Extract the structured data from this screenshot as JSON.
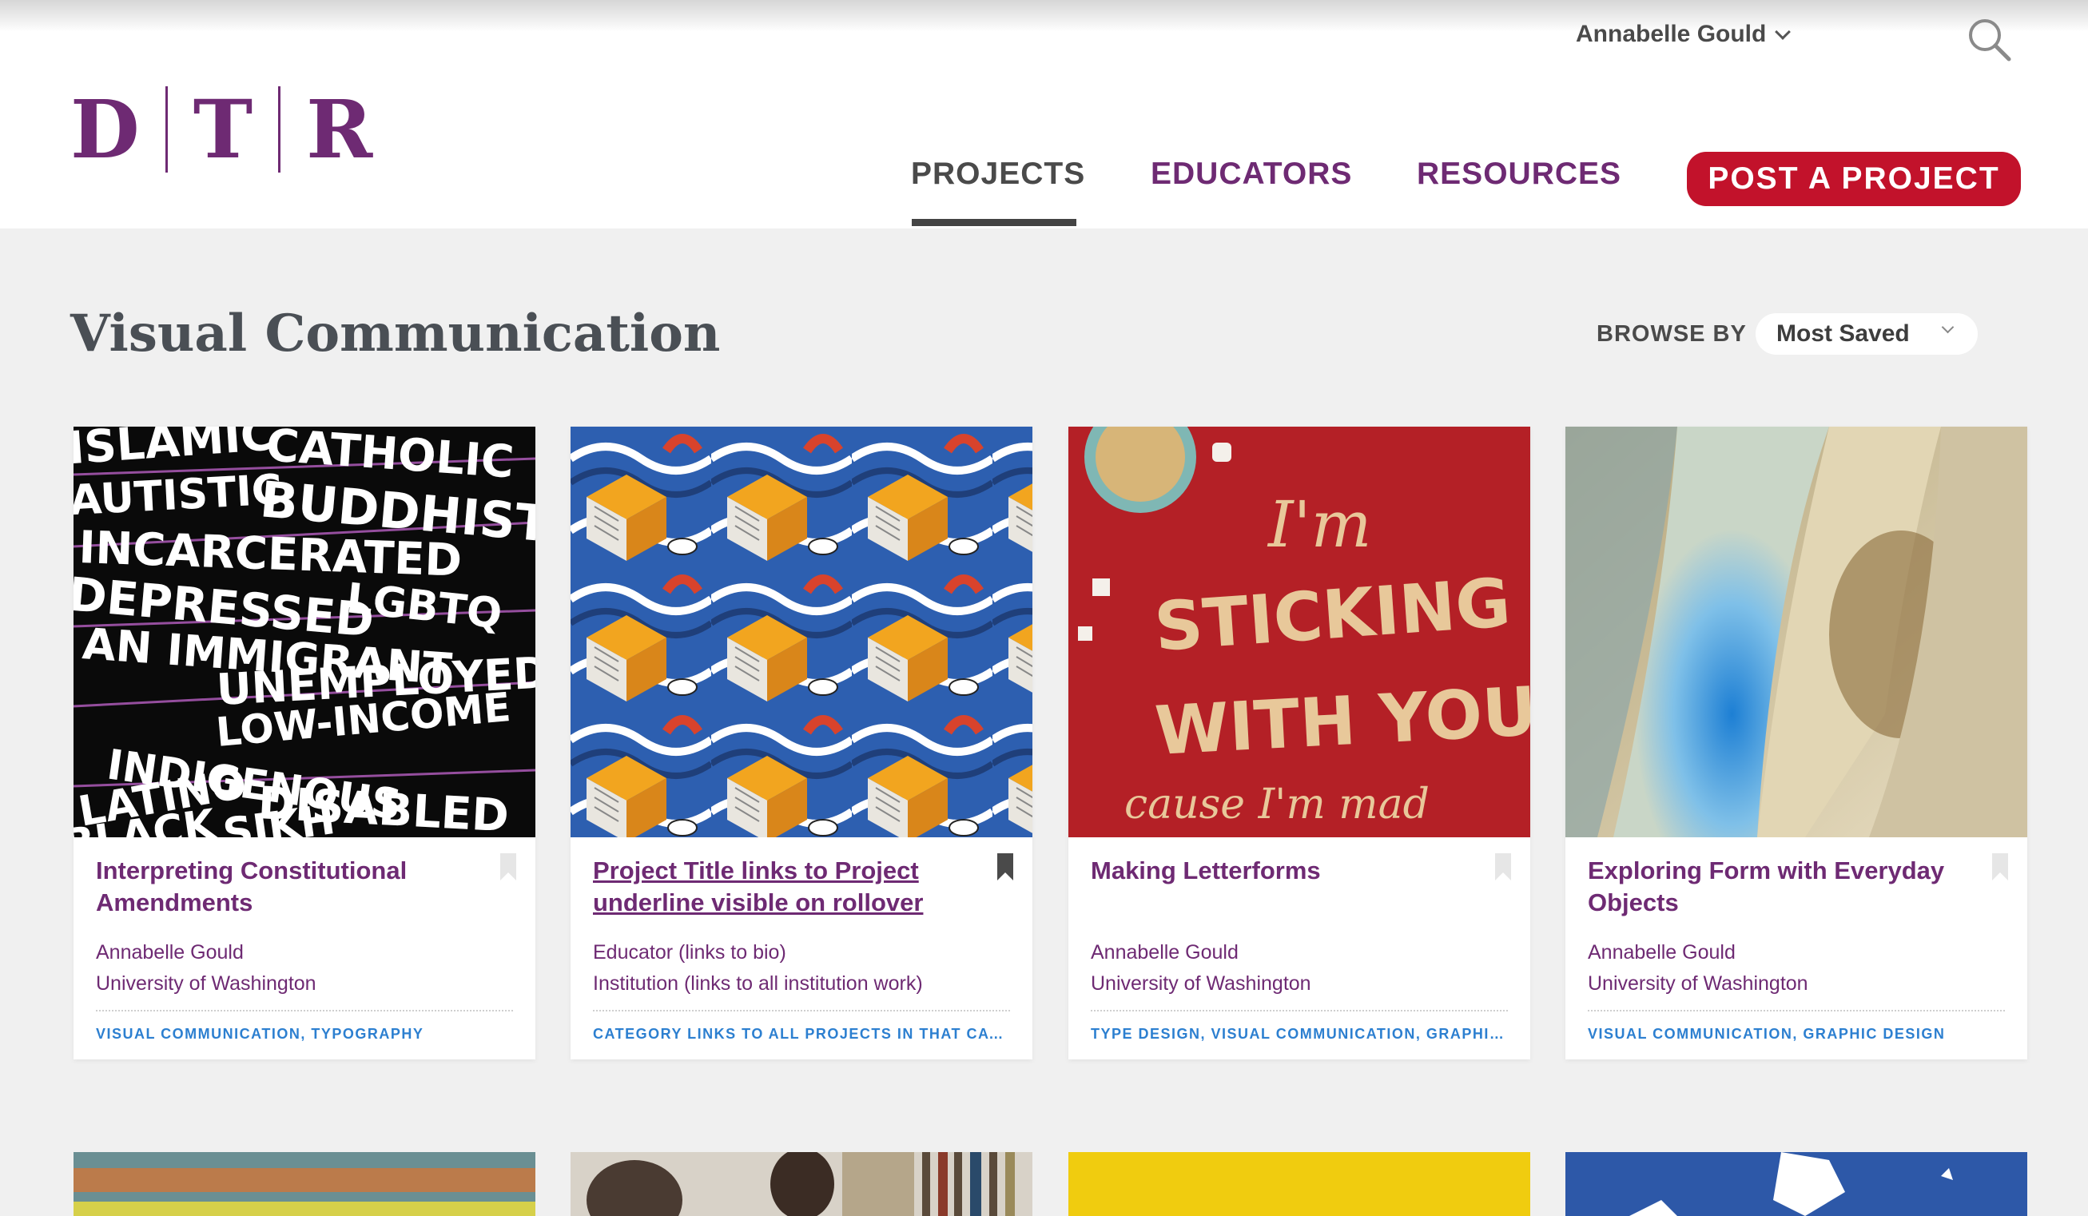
{
  "header": {
    "logo": [
      "D",
      "T",
      "R"
    ],
    "user_name": "Annabelle Gould",
    "nav": [
      {
        "label": "PROJECTS",
        "active": true
      },
      {
        "label": "EDUCATORS",
        "active": false
      },
      {
        "label": "RESOURCES",
        "active": false
      }
    ],
    "post_button": "POST A PROJECT"
  },
  "page": {
    "title": "Visual Communication",
    "browse_label": "BROWSE BY",
    "browse_value": "Most Saved"
  },
  "cards": [
    {
      "title": "Interpreting Constitutional Amendments",
      "educator": "Annabelle Gould",
      "institution": "University of Washington",
      "categories": "VISUAL COMMUNICATION, TYPOGRAPHY",
      "bookmarked": false,
      "thumb_words": [
        "ISLAMIC",
        "CATHOLIC",
        "AUTISTIC",
        "BUDDHIST",
        "INCARCERATED",
        "DEPRESSED",
        "LGBTQ",
        "AN IMMIGRANT",
        "UNEMPLOYED",
        "LOW-INCOME",
        "INDIGENOUS",
        "LATINO",
        "DISABLED",
        "BLACK",
        "SIKH"
      ]
    },
    {
      "title": "Project Title links to Project underline visible on rollover",
      "educator": "Educator (links to bio)",
      "institution": "Institution (links to all institution work)",
      "categories": "CATEGORY LINKS TO ALL PROJECTS IN THAT CATEG...",
      "bookmarked": true
    },
    {
      "title": "Making Letterforms",
      "educator": "Annabelle Gould",
      "institution": "University of Washington",
      "categories": "TYPE DESIGN, VISUAL COMMUNICATION, GRAPHIC...",
      "bookmarked": false,
      "thumb_words": [
        "I'm",
        "STICKING",
        "WITH YOU",
        "cause I'm mad"
      ]
    },
    {
      "title": "Exploring Form with Everyday Objects",
      "educator": "Annabelle Gould",
      "institution": "University of Washington",
      "categories": "VISUAL COMMUNICATION, GRAPHIC DESIGN",
      "bookmarked": false
    }
  ],
  "colors": {
    "brand_purple": "#6e2a73",
    "cta_red": "#c2122b",
    "category_blue": "#2c7fd0",
    "page_bg": "#f0f0f0"
  },
  "icons": [
    "search-icon",
    "chevron-down-icon",
    "bookmark-icon"
  ]
}
